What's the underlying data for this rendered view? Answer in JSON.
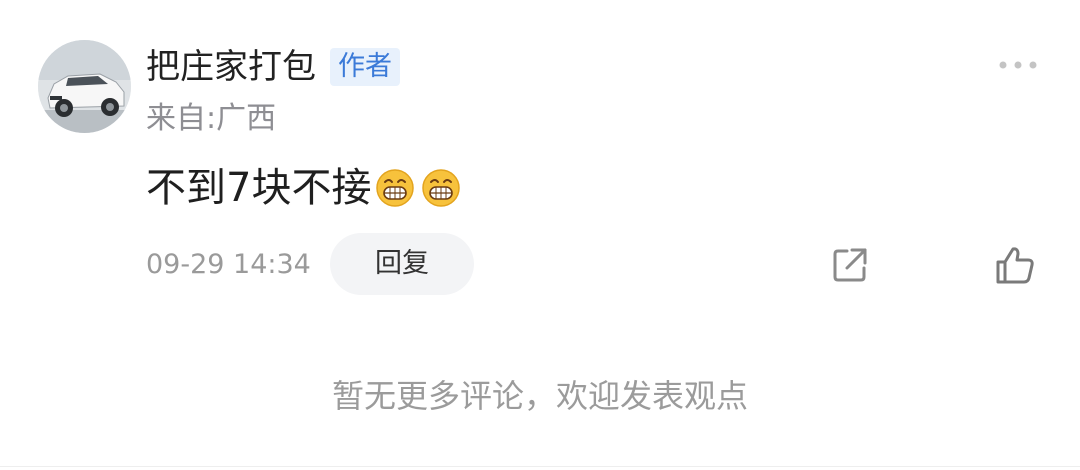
{
  "comment": {
    "avatar_icon": "avatar-white-suv",
    "username": "把庄家打包",
    "author_badge": "作者",
    "location": "来自:广西",
    "text": "不到7块不接",
    "emojis": [
      "grinning-face-emoji",
      "grinning-face-emoji"
    ],
    "time": "09-29 14:34",
    "reply_label": "回复",
    "more_icon": "more-dots-icon",
    "share_icon": "share-icon",
    "like_icon": "thumbs-up-icon"
  },
  "footer": {
    "no_more_text": "暂无更多评论，欢迎发表观点"
  },
  "colors": {
    "badge_text": "#3b7ad8",
    "badge_bg": "#e8f1fc",
    "muted_text": "#8e8e93",
    "reply_bg": "#f3f4f6",
    "emoji_fill": "#f7c23c"
  }
}
